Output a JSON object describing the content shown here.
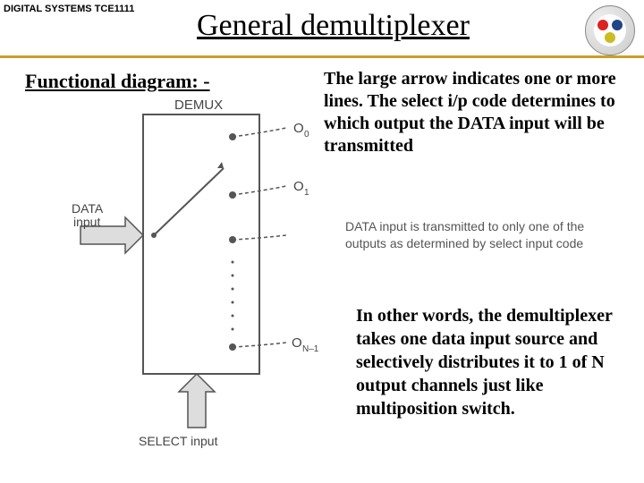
{
  "header": {
    "course_label": "DIGITAL SYSTEMS TCE1111",
    "title": "General demultiplexer"
  },
  "subhead": "Functional diagram: -",
  "note": "The large arrow indicates one or more lines. The select i/p code determines to which   output the DATA  input will be transmitted",
  "caption": "DATA input is transmitted to only one of the outputs as determined by select input code",
  "paragraph": "In other words, the demultiplexer takes one data input source and selectively distributes it to 1 of N output channels just like multiposition switch.",
  "diagram_labels": {
    "block": "DEMUX",
    "data_in": "DATA",
    "data_in2": "input",
    "select": "SELECT input",
    "out0": "O",
    "out0_sub": "0",
    "out1": "O",
    "out1_sub": "1",
    "outn": "O",
    "outn_sub": "N–1"
  }
}
